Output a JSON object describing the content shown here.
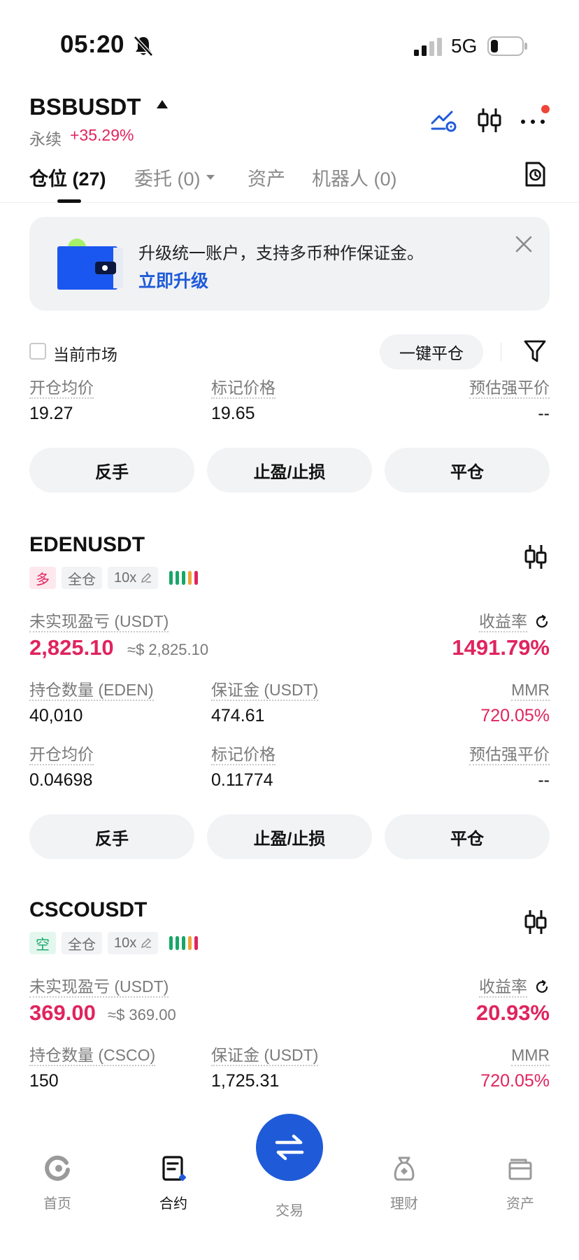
{
  "status_bar": {
    "time": "05:20",
    "network": "5G"
  },
  "header": {
    "symbol": "BSBUSDT",
    "type": "永续",
    "change": "+35.29%"
  },
  "tabs": [
    {
      "label": "仓位 (27)"
    },
    {
      "label": "委托 (0)"
    },
    {
      "label": "资产"
    },
    {
      "label": "机器人 (0)"
    }
  ],
  "banner": {
    "text": "升级统一账户，支持多币种作保证金。",
    "link": "立即升级"
  },
  "filter": {
    "current_market": "当前市场",
    "close_all": "一键平仓"
  },
  "top_position": {
    "entry_label": "开仓均价",
    "entry": "19.27",
    "mark_label": "标记价格",
    "mark": "19.65",
    "liq_label": "预估强平价",
    "liq": "--"
  },
  "actions": {
    "reverse": "反手",
    "tpsl": "止盈/止损",
    "close": "平仓"
  },
  "positions": [
    {
      "symbol": "EDENUSDT",
      "side": "多",
      "margin_mode": "全仓",
      "leverage": "10x",
      "pnl_label": "未实现盈亏 (USDT)",
      "pnl": "2,825.10",
      "pnl_approx": "≈$ 2,825.10",
      "roe_label": "收益率",
      "roe": "1491.79%",
      "size_label": "持仓数量 (EDEN)",
      "size": "40,010",
      "margin_label": "保证金 (USDT)",
      "margin": "474.61",
      "mmr_label": "MMR",
      "mmr": "720.05%",
      "entry_label": "开仓均价",
      "entry": "0.04698",
      "mark_label": "标记价格",
      "mark": "0.11774",
      "liq_label": "预估强平价",
      "liq": "--"
    },
    {
      "symbol": "CSCOUSDT",
      "side": "空",
      "margin_mode": "全仓",
      "leverage": "10x",
      "pnl_label": "未实现盈亏 (USDT)",
      "pnl": "369.00",
      "pnl_approx": "≈$ 369.00",
      "roe_label": "收益率",
      "roe": "20.93%",
      "size_label": "持仓数量 (CSCO)",
      "size": "150",
      "margin_label": "保证金 (USDT)",
      "margin": "1,725.31",
      "mmr_label": "MMR",
      "mmr": "720.05%"
    }
  ],
  "bottom_nav": [
    {
      "label": "首页",
      "icon": "home-icon"
    },
    {
      "label": "合约",
      "icon": "contract-icon"
    },
    {
      "label": "交易",
      "icon": "trade-swap-icon"
    },
    {
      "label": "理财",
      "icon": "finance-icon"
    },
    {
      "label": "资产",
      "icon": "wallet-icon"
    }
  ],
  "colors": {
    "accent_blue": "#1f5bd8",
    "profit_red": "#e0245e",
    "short_green": "#17a668"
  }
}
